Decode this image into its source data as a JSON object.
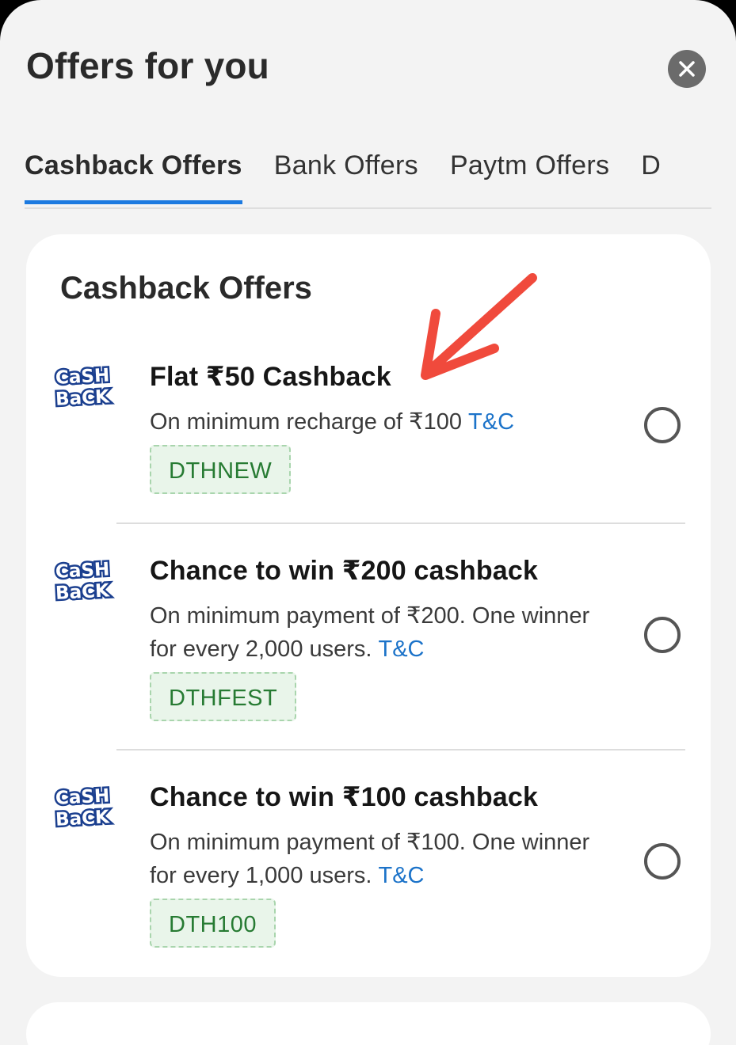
{
  "header": {
    "title": "Offers for you",
    "close_icon": "close-icon"
  },
  "tabs": [
    {
      "label": "Cashback Offers",
      "active": true
    },
    {
      "label": "Bank Offers",
      "active": false
    },
    {
      "label": "Paytm Offers",
      "active": false
    },
    {
      "label": "D",
      "active": false
    }
  ],
  "section": {
    "title": "Cashback Offers",
    "offers": [
      {
        "logo_top": "CaSH",
        "logo_bottom": "BaCK",
        "title": "Flat ₹50 Cashback",
        "description": "On minimum recharge of ₹100",
        "tnc": "T&C",
        "code": "DTHNEW",
        "selected": false
      },
      {
        "logo_top": "CaSH",
        "logo_bottom": "BaCK",
        "title": "Chance to win ₹200 cashback",
        "description": "On minimum payment of ₹200. One winner for every 2,000 users.",
        "tnc": "T&C",
        "code": "DTHFEST",
        "selected": false
      },
      {
        "logo_top": "CaSH",
        "logo_bottom": "BaCK",
        "title": "Chance to win ₹100 cashback",
        "description": "On minimum payment of ₹100. One winner for every 1,000 users.",
        "tnc": "T&C",
        "code": "DTH100",
        "selected": false
      }
    ]
  },
  "colors": {
    "accent_tab": "#1c7ae0",
    "link": "#1c73c9",
    "code_bg": "#e9f5ea",
    "code_text": "#277b33",
    "annotation_arrow": "#f04a3c"
  }
}
